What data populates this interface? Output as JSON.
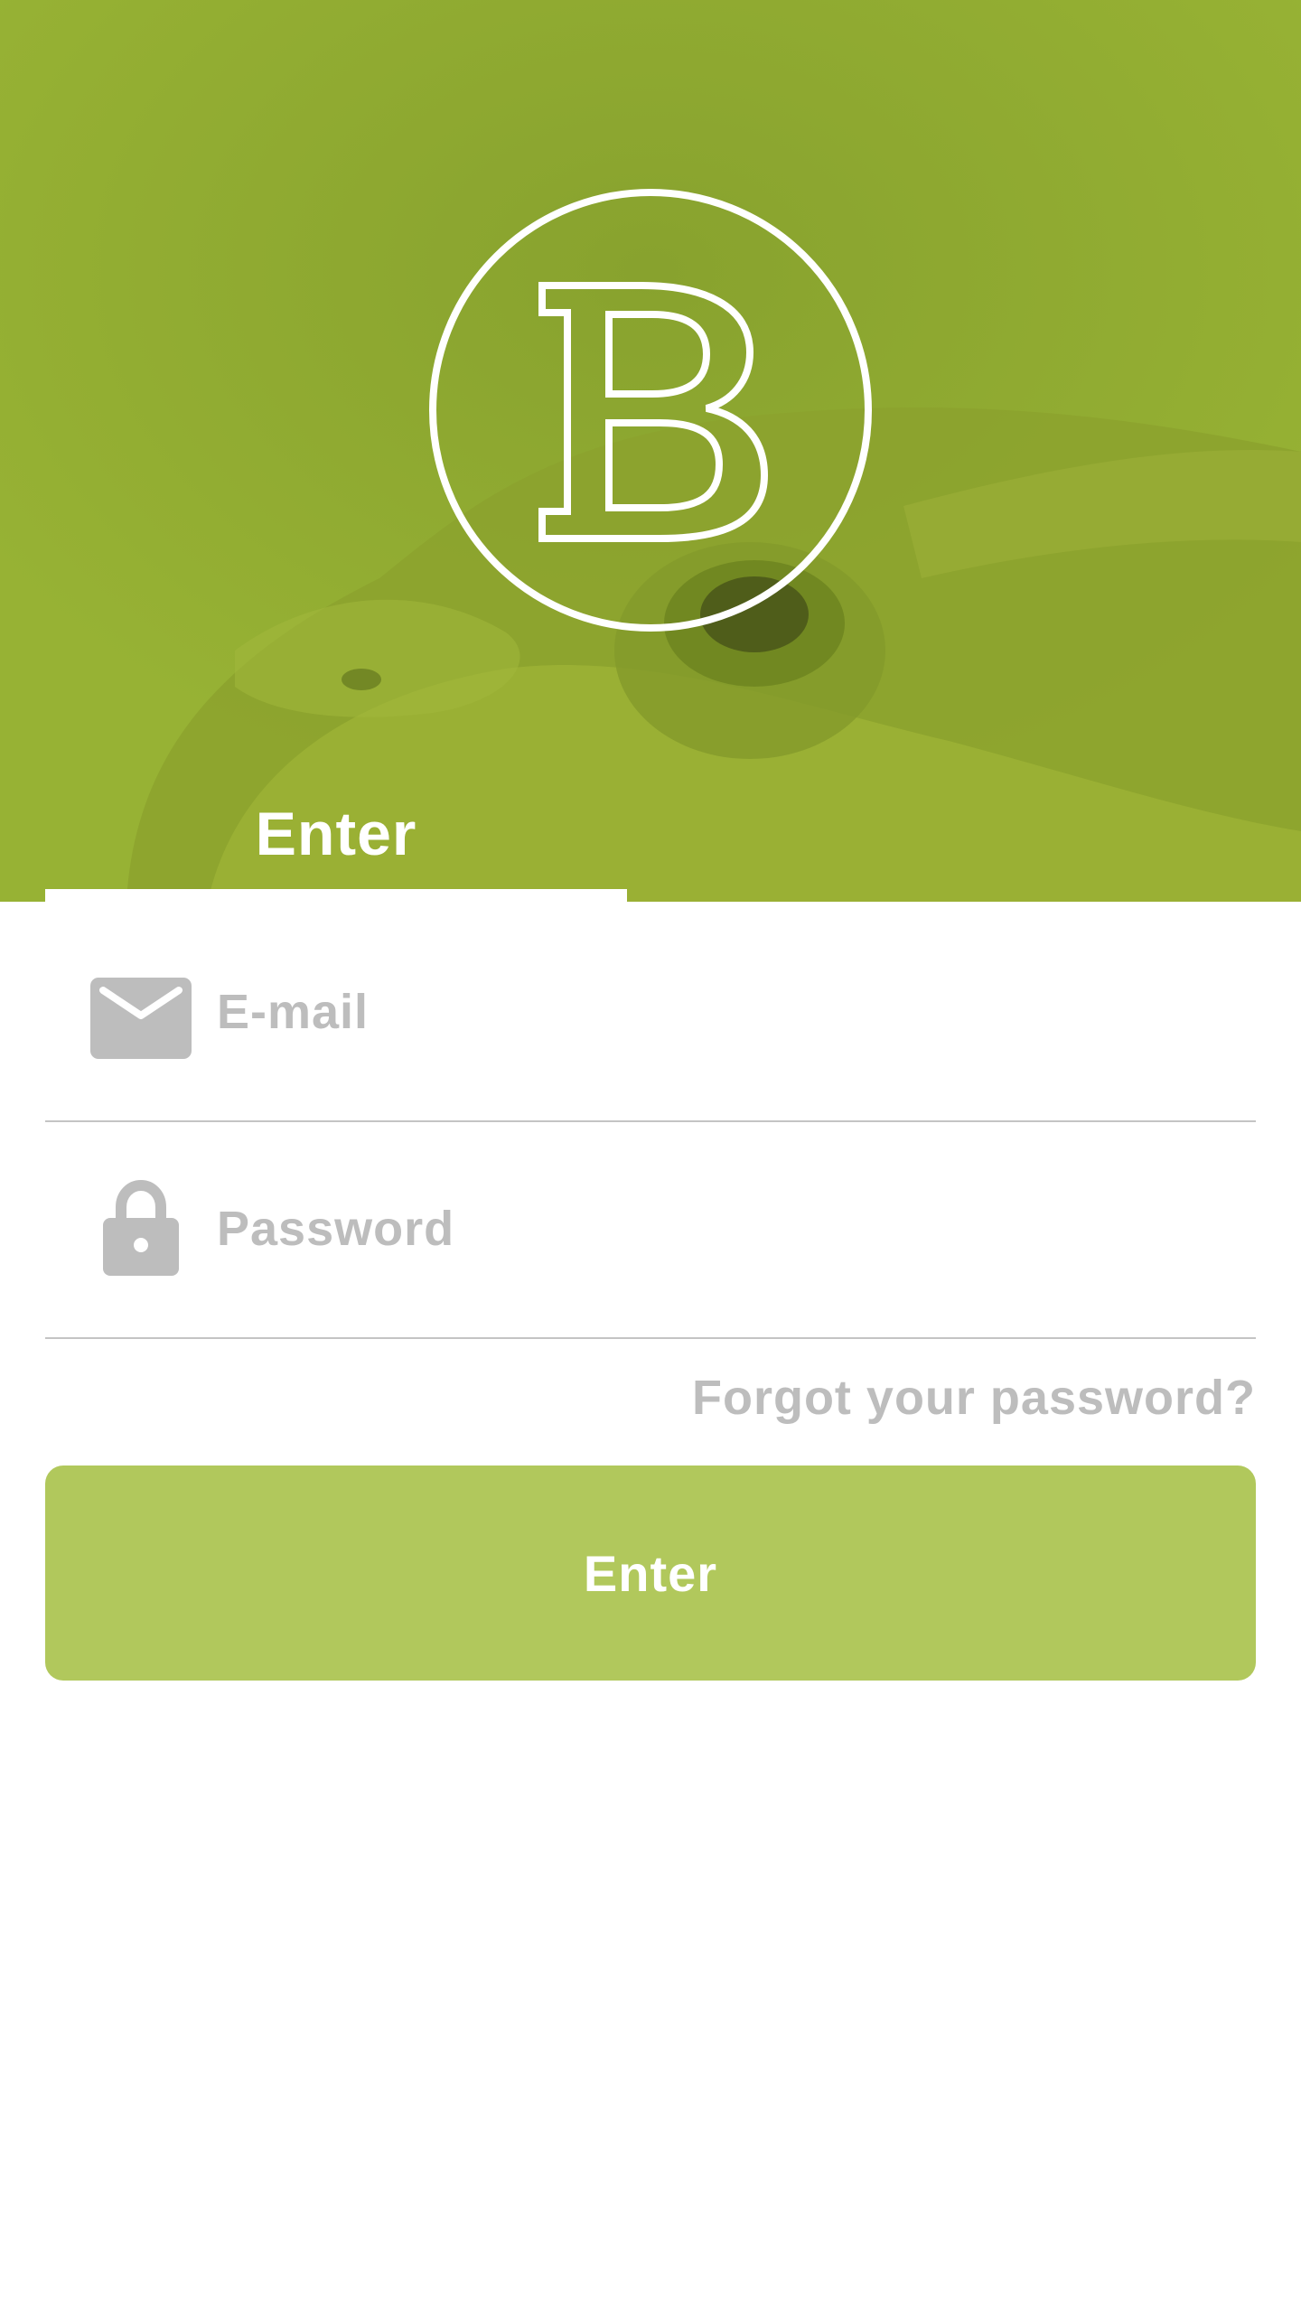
{
  "colors": {
    "header_overlay": "#92ad33",
    "accent_button": "#b1c85c",
    "muted_text": "#bdbdbd",
    "divider": "#c4c4c4",
    "white": "#ffffff"
  },
  "header": {
    "logo_letter": "B",
    "background_image": "frog-photo",
    "tab": {
      "label": "Enter",
      "selected": true
    }
  },
  "form": {
    "email": {
      "placeholder": "E-mail",
      "value": "",
      "icon": "mail-icon"
    },
    "password": {
      "placeholder": "Password",
      "value": "",
      "icon": "lock-icon"
    },
    "forgot_label": "Forgot your password?",
    "submit_label": "Enter"
  }
}
